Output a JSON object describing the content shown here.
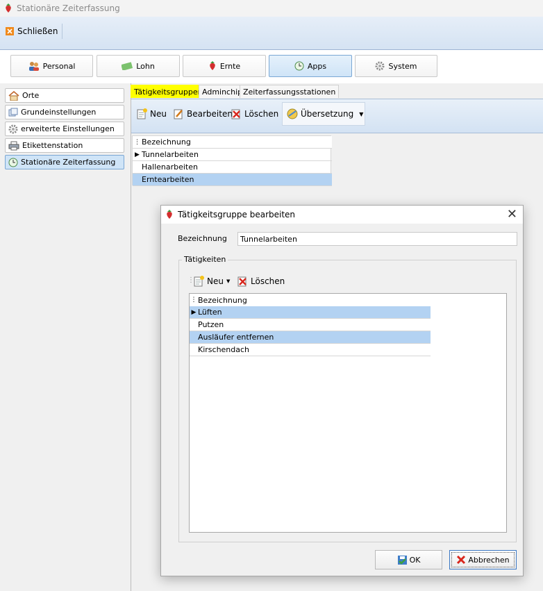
{
  "window": {
    "title": "Stationäre Zeiterfassung"
  },
  "ribbon": {
    "close_label": "Schließen"
  },
  "nav": [
    {
      "label": "Personal",
      "icon": "people-icon"
    },
    {
      "label": "Lohn",
      "icon": "money-icon"
    },
    {
      "label": "Ernte",
      "icon": "strawberry-icon"
    },
    {
      "label": "Apps",
      "icon": "clock-icon"
    },
    {
      "label": "System",
      "icon": "gear-icon"
    }
  ],
  "sidebar": {
    "items": [
      {
        "label": "Orte",
        "icon": "home-icon"
      },
      {
        "label": "Grundeinstellungen",
        "icon": "settings-icon"
      },
      {
        "label": "erweiterte Einstellungen",
        "icon": "gear-icon"
      },
      {
        "label": "Etikettenstation",
        "icon": "printer-icon"
      },
      {
        "label": "Stationäre Zeiterfassung",
        "icon": "clock-icon"
      }
    ]
  },
  "tabs": [
    {
      "label": "Tätigkeitsgruppen"
    },
    {
      "label": "Adminchip"
    },
    {
      "label": "Zeiterfassungsstationen"
    }
  ],
  "toolbar": {
    "new_label": "Neu",
    "edit_label": "Bearbeiten",
    "delete_label": "Löschen",
    "translate_label": "Übersetzung"
  },
  "grid": {
    "header": "Bezeichnung",
    "rows": [
      "Tunnelarbeiten",
      "Hallenarbeiten",
      "Erntearbeiten"
    ]
  },
  "dialog": {
    "title": "Tätigkeitsgruppe bearbeiten",
    "field_label": "Bezeichnung",
    "field_value": "Tunnelarbeiten",
    "group_title": "Tätigkeiten",
    "new_label": "Neu",
    "delete_label": "Löschen",
    "grid_header": "Bezeichnung",
    "rows": [
      "Lüften",
      "Putzen",
      "Ausläufer entfernen",
      "Kirschendach"
    ],
    "ok_label": "OK",
    "cancel_label": "Abbrechen"
  },
  "colors": {
    "selection": "#b3d2f2",
    "highlight_tab": "#ffff00",
    "ribbon": "#d5e3f3"
  }
}
